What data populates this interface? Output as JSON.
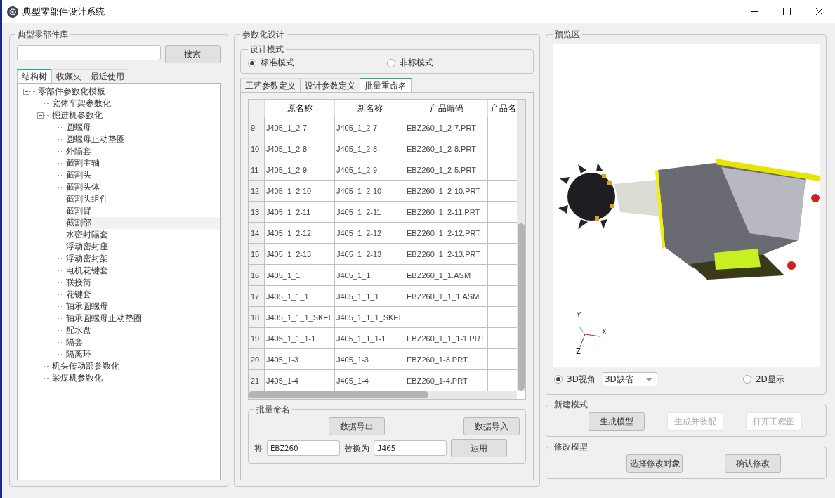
{
  "window": {
    "title": "典型零部件设计系统"
  },
  "library": {
    "title": "典型零部件库",
    "search_button": "搜索",
    "tabs": [
      {
        "label": "结构树",
        "selected": true
      },
      {
        "label": "收藏夹",
        "selected": false
      },
      {
        "label": "最近使用",
        "selected": false
      }
    ],
    "tree": [
      {
        "label": "零部件参数化模板",
        "expanded": true,
        "selected": false,
        "children": [
          {
            "label": "宽体车架参数化",
            "selected": false
          },
          {
            "label": "掘进机参数化",
            "expanded": true,
            "selected": false,
            "children": [
              {
                "label": "圆螺母",
                "selected": false
              },
              {
                "label": "圆螺母止动垫圈",
                "selected": false
              },
              {
                "label": "外隔套",
                "selected": false
              },
              {
                "label": "截割主轴",
                "selected": false
              },
              {
                "label": "截割头",
                "selected": false
              },
              {
                "label": "截割头体",
                "selected": false
              },
              {
                "label": "截割头组件",
                "selected": false
              },
              {
                "label": "截割臂",
                "selected": false
              },
              {
                "label": "截割部",
                "selected": true
              },
              {
                "label": "水密封隔套",
                "selected": false
              },
              {
                "label": "浮动密封座",
                "selected": false
              },
              {
                "label": "浮动密封架",
                "selected": false
              },
              {
                "label": "电机花键套",
                "selected": false
              },
              {
                "label": "联接筒",
                "selected": false
              },
              {
                "label": "花键套",
                "selected": false
              },
              {
                "label": "轴承圆螺母",
                "selected": false
              },
              {
                "label": "轴承圆螺母止动垫圈",
                "selected": false
              },
              {
                "label": "配水盘",
                "selected": false
              },
              {
                "label": "隔套",
                "selected": false
              },
              {
                "label": "隔离环",
                "selected": false
              }
            ]
          },
          {
            "label": "机头传动部参数化",
            "selected": false
          },
          {
            "label": "采煤机参数化",
            "selected": false
          }
        ]
      }
    ]
  },
  "design": {
    "title": "参数化设计",
    "mode": {
      "title": "设计模式",
      "options": [
        {
          "label": "标准模式",
          "selected": true
        },
        {
          "label": "非标模式",
          "selected": false
        }
      ]
    },
    "tabs": [
      {
        "label": "工艺参数定义",
        "selected": false
      },
      {
        "label": "设计参数定义",
        "selected": false
      },
      {
        "label": "批量重命名",
        "selected": true
      }
    ],
    "table": {
      "columns": [
        "原名称",
        "新名称",
        "产品编码",
        "产品名"
      ],
      "rows": [
        {
          "index": "9",
          "cells": [
            "J405_1_2-7",
            "J405_1_2-7",
            "EBZ260_1_2-7.PRT"
          ]
        },
        {
          "index": "10",
          "cells": [
            "J405_1_2-8",
            "J405_1_2-8",
            "EBZ260_1_2-8.PRT"
          ]
        },
        {
          "index": "11",
          "cells": [
            "J405_1_2-9",
            "J405_1_2-9",
            "EBZ260_1_2-5.PRT"
          ]
        },
        {
          "index": "12",
          "cells": [
            "J405_1_2-10",
            "J405_1_2-10",
            "EBZ260_1_2-10.PRT"
          ]
        },
        {
          "index": "13",
          "cells": [
            "J405_1_2-11",
            "J405_1_2-11",
            "EBZ260_1_2-11.PRT"
          ]
        },
        {
          "index": "14",
          "cells": [
            "J405_1_2-12",
            "J405_1_2-12",
            "EBZ260_1_2-12.PRT"
          ]
        },
        {
          "index": "15",
          "cells": [
            "J405_1_2-13",
            "J405_1_2-13",
            "EBZ260_1_2-13.PRT"
          ]
        },
        {
          "index": "16",
          "cells": [
            "J405_1_1",
            "J405_1_1",
            "EBZ260_1_1.ASM"
          ]
        },
        {
          "index": "17",
          "cells": [
            "J405_1_1_1",
            "J405_1_1_1",
            "EBZ260_1_1_1.ASM"
          ]
        },
        {
          "index": "18",
          "cells": [
            "J405_1_1_1_SKEL",
            "J405_1_1_1_SKEL"
          ]
        },
        {
          "index": "19",
          "cells": [
            "J405_1_1_1-1",
            "J405_1_1_1-1",
            "EBZ260_1_1_1-1.PRT"
          ]
        },
        {
          "index": "20",
          "cells": [
            "J405_1-3",
            "J405_1-3",
            "EBZ260_1-3.PRT"
          ]
        },
        {
          "index": "21",
          "cells": [
            "J405_1-4",
            "J405_1-4",
            "EBZ260_1-4.PRT"
          ]
        }
      ]
    },
    "rename": {
      "title": "批量命名",
      "export_button": "数据导出",
      "import_button": "数据导入",
      "from_label": "将",
      "from_value": "EBZ260",
      "to_label": "替换为",
      "to_value": "J405",
      "apply_button": "运用"
    }
  },
  "preview": {
    "title": "预览区",
    "axes": {
      "y": "Y",
      "x": "X",
      "z": "Z"
    },
    "view_options": [
      {
        "label": "3D视角",
        "selected": true
      },
      {
        "label": "2D显示",
        "selected": false
      }
    ],
    "view_select": "3D缺省"
  },
  "create": {
    "title": "新建模式",
    "buttons": [
      {
        "label": "生成模型",
        "disabled": false
      },
      {
        "label": "生成并装配",
        "disabled": true
      },
      {
        "label": "打开工程图",
        "disabled": true
      }
    ]
  },
  "modify": {
    "title": "修改模型",
    "buttons": [
      {
        "label": "选择修改对象",
        "disabled": false
      },
      {
        "label": "确认修改",
        "disabled": false
      }
    ]
  }
}
